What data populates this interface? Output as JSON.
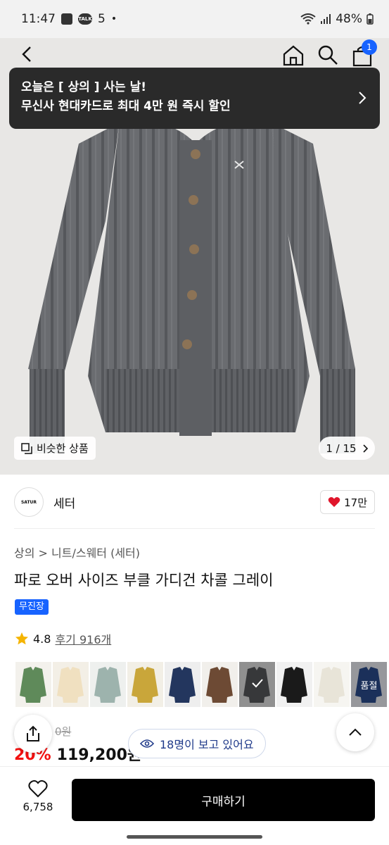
{
  "status": {
    "time": "11:47",
    "count": "5",
    "battery": "48%"
  },
  "promo": {
    "line1": "오늘은 [ 상의 ] 사는 날!",
    "line2": "무신사 현대카드로 최대 4만 원 즉시 할인"
  },
  "header": {
    "cart_count": "1"
  },
  "gallery": {
    "similar_label": "비슷한 상품",
    "page": "1 / 15"
  },
  "brand": {
    "logo_text": "SATUR",
    "name": "세터",
    "likes": "17만"
  },
  "product": {
    "breadcrumb": "상의 > 니트/스웨터 (세터)",
    "title": "파로 오버 사이즈 부클 가디건 차콜 그레이",
    "tag": "무진장",
    "rating": "4.8",
    "reviews": "후기 916개"
  },
  "variants": [
    {
      "color": "#5f8a5a",
      "bg": "#f3f1ec"
    },
    {
      "color": "#f0e0c0",
      "bg": "#f3efe6"
    },
    {
      "color": "#9db3ad",
      "bg": "#eef0ee"
    },
    {
      "color": "#c9a63a",
      "bg": "#f2efe6"
    },
    {
      "color": "#23365e",
      "bg": "#eeeeee"
    },
    {
      "color": "#6d4a34",
      "bg": "#f1efeb"
    },
    {
      "color": "#55565a",
      "bg": "#dedede"
    },
    {
      "color": "#1a1a1a",
      "bg": "#f1f1f1"
    },
    {
      "color": "#e8e4d8",
      "bg": "#f6f5f1"
    },
    {
      "color": "#2a4a8a",
      "bg": "#e8eaf0"
    }
  ],
  "soldout_label": "품절",
  "price": {
    "original": "0원",
    "discount": "20%",
    "final": "119,200원"
  },
  "viewers": "18명이 보고 있어요",
  "bottom": {
    "wish_count": "6,758",
    "buy_label": "구매하기"
  }
}
